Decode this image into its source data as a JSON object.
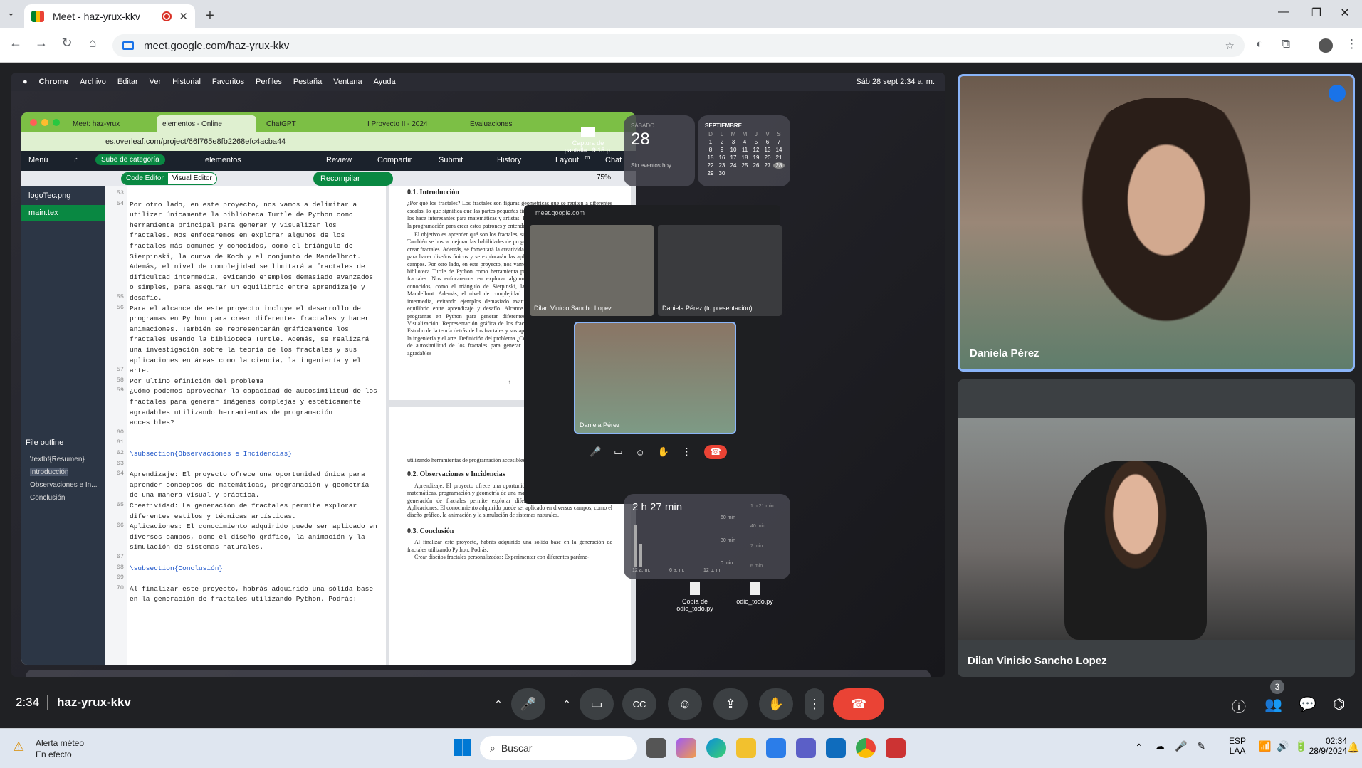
{
  "browser": {
    "tab_title": "Meet - haz-yrux-kkv",
    "url": "meet.google.com/haz-yrux-kkv"
  },
  "shared_screen": {
    "menubar": [
      "Chrome",
      "Archivo",
      "Editar",
      "Ver",
      "Historial",
      "Favoritos",
      "Perfiles",
      "Pestaña",
      "Ventana",
      "Ayuda"
    ],
    "clock": "Sáb 28 sept  2:34 a. m.",
    "inner_tabs": [
      "Meet: haz-yrux",
      "elementos - Online",
      "ChatGPT",
      "I Proyecto II - 2024",
      "Evaluaciones"
    ],
    "inner_url": "es.overleaf.com/project/66f765e8fb2268efc4acba44",
    "overleaf": {
      "menu": "Menú",
      "category": "Sube de categoría",
      "project": "elementos",
      "review": "Review",
      "share": "Compartir",
      "submit": "Submit",
      "history": "History",
      "layout": "Layout",
      "chat": "Chat",
      "code_editor": "Code Editor",
      "visual_editor": "Visual Editor",
      "recompile": "Recompilar",
      "zoom": "75%",
      "files": [
        "logoTec.png",
        "main.tex"
      ],
      "outline_title": "File outline",
      "outline": [
        "\\textbf{Resumen}",
        "Introducción",
        "Observaciones e In...",
        "Conclusión"
      ],
      "code": [
        {
          "n": "53",
          "t": ""
        },
        {
          "n": "54",
          "t": "Por otro lado, en este proyecto, nos vamos a delimitar a utilizar únicamente la biblioteca Turtle de Python como herramienta principal para generar y visualizar los fractales. Nos enfocaremos en explorar algunos de los fractales más comunes y conocidos, como el triángulo de Sierpinski, la curva de Koch y el conjunto de Mandelbrot. Además, el nivel de complejidad se limitará a fractales de dificultad intermedia, evitando ejemplos demasiado avanzados o simples, para asegurar un equilibrio entre aprendizaje y desafío."
        },
        {
          "n": "55",
          "t": ""
        },
        {
          "n": "56",
          "t": "Para el alcance de este proyecto incluye el desarrollo de programas en Python para crear diferentes fractales y hacer animaciones. También se representarán gráficamente los fractales usando la biblioteca Turtle. Además, se realizará una investigación sobre la teoría de los fractales y sus aplicaciones en áreas como la ciencia, la ingeniería y el arte."
        },
        {
          "n": "57",
          "t": ""
        },
        {
          "n": "58",
          "t": "Por ultimo efinición del problema"
        },
        {
          "n": "59",
          "t": "¿Cómo podemos aprovechar la capacidad de autosimilitud de los fractales para generar imágenes complejas y estéticamente agradables utilizando herramientas de programación accesibles?"
        },
        {
          "n": "60",
          "t": ""
        },
        {
          "n": "61",
          "t": ""
        },
        {
          "n": "62",
          "t": "\\subsection{Observaciones e Incidencias}"
        },
        {
          "n": "63",
          "t": ""
        },
        {
          "n": "64",
          "t": "Aprendizaje: El proyecto ofrece una oportunidad única para aprender conceptos de matemáticas, programación y geometría de una manera visual y práctica."
        },
        {
          "n": "65",
          "t": "Creatividad: La generación de fractales permite explorar diferentes estilos y técnicas artísticas."
        },
        {
          "n": "66",
          "t": "Aplicaciones: El conocimiento adquirido puede ser aplicado en diversos campos, como el diseño gráfico, la animación y la simulación de sistemas naturales."
        },
        {
          "n": "67",
          "t": ""
        },
        {
          "n": "68",
          "t": "\\subsection{Conclusión}"
        },
        {
          "n": "69",
          "t": ""
        },
        {
          "n": "70",
          "t": "Al finalizar este proyecto, habrás adquirido una sólida base en la generación de fractales utilizando Python. Podrás:"
        }
      ],
      "pdf": {
        "section1": "0.1.   Introducción",
        "para1": "¿Por qué los fractales? Los fractales son figuras geométricas que se repiten a diferentes escalas, lo que significa que las partes pequeñas tienen la misma forma que el todo. Esto los hace interesantes para matemáticas y artistas. En este proyecto, aprenderemos a usar la programación para crear estos patrones y entender cómo funcionan.",
        "para2": "El objetivo es aprender qué son los fractales, sus características y cómo se clasifican. También se busca mejorar las habilidades de programación usando Python y Turtle para crear fractales. Además, se fomentará la creatividad probando diferentes configuraciones para hacer diseños únicos y se explorarán las aplicaciones de los fractales en distintos campos. Por otro lado, en este proyecto, nos vamos a delimitar a utilizar únicamente la biblioteca Turtle de Python como herramienta principal para generar y visualizar los fractales. Nos enfocaremos en explorar algunos de los fractales más comunes y conocidos, como el triángulo de Sierpinski, la curva de Koch y el conjunto de Mandelbrot. Además, el nivel de complejidad se limitará a fractales de dificultad intermedia, evitando ejemplos demasiado avanzados o simples, para asegurar un equilibrio entre aprendizaje y desafío. Alcance Desarrollo de código: Creación de programas en Python para generar diferentes fractales y realizar animaciones. Visualización: Representación gráfica de los fractales utilizando Turtle. Investigación: Estudio de la teoría detrás de los fractales y sus aplicaciones en campos como la ciencia, la ingeniería y el arte. Definición del problema ¿Cómo podemos aprovechar la capacidad de autosimilitud de los fractales para generar imágenes complejas y estéticamente agradables",
        "page_num": "1",
        "page2_top": "utilizando herramientas de programación accesibles?",
        "section2": "0.2.   Observaciones e Incidencias",
        "para3": "Aprendizaje: El proyecto ofrece una oportunidad única para aprender conceptos de matemáticas, programación y geometría de una manera visual y práctica. Creatividad: La generación de fractales permite explorar diferentes estilos y técnicas artísticas. Aplicaciones: El conocimiento adquirido puede ser aplicado en diversos campos, como el diseño gráfico, la animación y la simulación de sistemas naturales.",
        "section3": "0.3.   Conclusión",
        "para4": "Al finalizar este proyecto, habrás adquirido una sólida base en la generación de fractales utilizando Python. Podrás:",
        "para5": "Crear diseños fractales personalizados: Experimentar con diferentes paráme-"
      }
    },
    "screenshot_label": "Captura de pantalla...9.15 p. m.",
    "date_widget": {
      "day_name": "SÁBADO",
      "day": "28",
      "events": "Sin eventos hoy"
    },
    "calendar": {
      "month": "SEPTIEMBRE",
      "weekdays": [
        "D",
        "L",
        "M",
        "M",
        "J",
        "V",
        "S"
      ],
      "rows": [
        [
          "1",
          "2",
          "3",
          "4",
          "5",
          "6",
          "7"
        ],
        [
          "8",
          "9",
          "10",
          "11",
          "12",
          "13",
          "14"
        ],
        [
          "15",
          "16",
          "17",
          "18",
          "19",
          "20",
          "21"
        ],
        [
          "22",
          "23",
          "24",
          "25",
          "26",
          "27",
          "28"
        ],
        [
          "29",
          "30",
          "",
          "",
          "",
          "",
          ""
        ]
      ]
    },
    "mini_meet": {
      "url": "meet.google.com",
      "p1": "Dilan Vinicio Sancho Lopez",
      "p2": "Daniela Pérez (tu presentación)",
      "p3": "Daniela Pérez"
    },
    "screen_time": {
      "total": "2 h 27 min",
      "labels": [
        "60 min",
        "30 min",
        "0 min"
      ],
      "xlabels": [
        "12 a. m.",
        "6 a. m.",
        "12 p. m."
      ],
      "apps": [
        "1 h 21 min",
        "40 min",
        "7 min",
        "6 min"
      ]
    },
    "desktop_files": [
      "Copia de odio_todo.py",
      "odio_todo.py"
    ]
  },
  "participants": [
    {
      "name": "Daniela Pérez"
    },
    {
      "name": "Dilan Vinicio Sancho Lopez"
    }
  ],
  "meet_bar": {
    "time": "2:34",
    "code": "haz-yrux-kkv",
    "people_count": "3"
  },
  "taskbar": {
    "weather_title": "Alerta méteo",
    "weather_sub": "En efecto",
    "search": "Buscar",
    "lang": "ESP",
    "lang2": "LAA",
    "time": "02:34",
    "date": "28/9/2024"
  }
}
